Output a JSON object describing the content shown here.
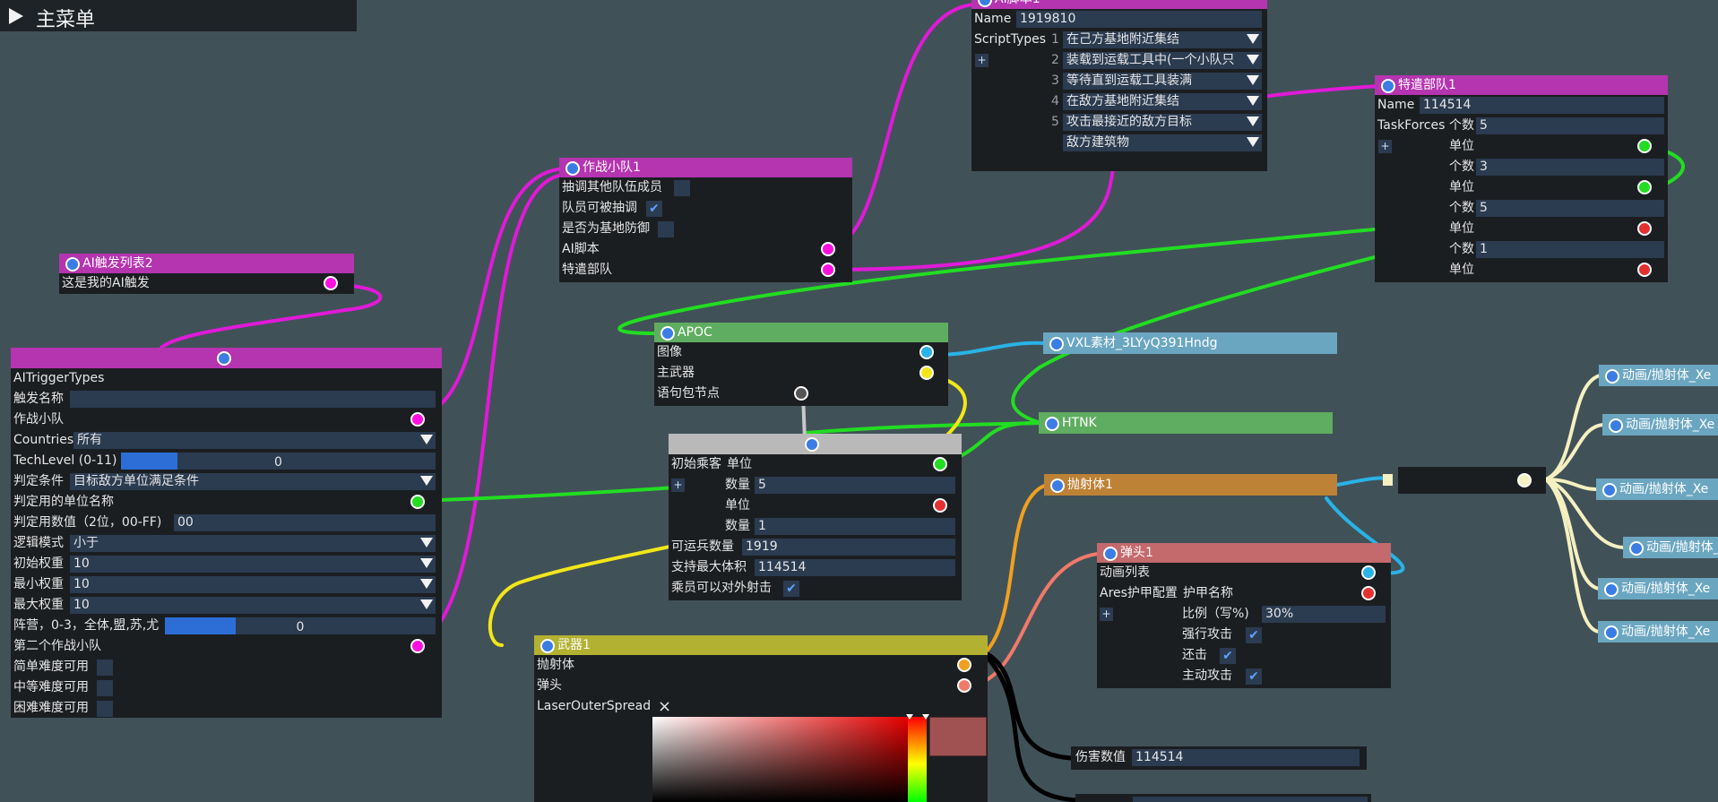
{
  "menu": {
    "title": "主菜单"
  },
  "colors": {
    "pink": "#b534b0",
    "green": "#5fad60",
    "grey": "#b9b9b9",
    "olive": "#b3b131",
    "orange": "#bd8236",
    "salmon": "#c4696c",
    "steel": "#6ba6c1"
  },
  "ai_trigger_list": {
    "title": "AI触发列表2",
    "text": "这是我的AI触发"
  },
  "ai_trigger": {
    "heading": "AITriggerTypes",
    "name_label": "触发名称",
    "team_label": "作战小队",
    "countries_label": "Countries",
    "countries_value": "所有",
    "techlevel_label": "TechLevel (0-11)",
    "techlevel_value": "0",
    "techlevel_fill": 0.18,
    "condition_label": "判定条件",
    "condition_value": "目标敌方单位满足条件",
    "unit_name_label": "判定用的单位名称",
    "hex_label": "判定用数值（2位，00-FF)",
    "hex_value": "00",
    "logic_label": "逻辑模式",
    "logic_value": "小于",
    "init_weight_label": "初始权重",
    "init_weight_value": "10",
    "min_weight_label": "最小权重",
    "min_weight_value": "10",
    "max_weight_label": "最大权重",
    "max_weight_value": "10",
    "camp_label": "阵营，0-3，全体,盟,苏,尤",
    "camp_value": "0",
    "camp_fill": 0.26,
    "second_team_label": "第二个作战小队",
    "easy_label": "简单难度可用",
    "medium_label": "中等难度可用",
    "hard_label": "困难难度可用"
  },
  "team": {
    "title": "作战小队1",
    "recruit_label": "抽调其他队伍成员",
    "can_be_recruited_label": "队员可被抽调",
    "base_defense_label": "是否为基地防御",
    "script_label": "AI脚本",
    "taskforce_label": "特遣部队"
  },
  "script": {
    "title": "AI脚本1",
    "name_label": "Name",
    "name_value": "1919810",
    "types_label": "ScriptTypes",
    "plus": "+",
    "items": [
      {
        "num": "1",
        "text": "在己方基地附近集结"
      },
      {
        "num": "2",
        "text": "装载到运载工具中(一个小队只"
      },
      {
        "num": "3",
        "text": "等待直到运载工具装满"
      },
      {
        "num": "4",
        "text": "在敌方基地附近集结"
      },
      {
        "num": "5",
        "text": "攻击最接近的敌方目标"
      },
      {
        "num": "",
        "text": "敌方建筑物"
      }
    ]
  },
  "taskforce": {
    "title": "特遣部队1",
    "name_label": "Name",
    "name_value": "114514",
    "tf_label": "TaskForces",
    "count_label": "个数",
    "count_value": "5",
    "plus": "+",
    "unit_label": "单位",
    "counts": [
      "3",
      "5",
      "1"
    ]
  },
  "apoc": {
    "title": "APOC",
    "image_label": "图像",
    "weapon_label": "主武器",
    "bundle_label": "语句包节点"
  },
  "vxl": {
    "title": "VXL素材_3LYyQ391Hndg"
  },
  "htnk": {
    "title": "HTNK"
  },
  "passengers": {
    "init_label": "初始乘客",
    "unit_label": "单位",
    "plus": "+",
    "count_label": "数量",
    "count1": "5",
    "count2": "1",
    "transport_label": "可运兵数量",
    "transport_value": "1919",
    "volume_label": "支持最大体积",
    "volume_value": "114514",
    "fire_label": "乘员可以对外射击"
  },
  "projectile": {
    "title": "抛射体1"
  },
  "warhead": {
    "title": "弹头1",
    "anim_label": "动画列表",
    "armor_label": "Ares护甲配置",
    "armor_name_label": "护甲名称",
    "plus": "+",
    "ratio_label": "比例（写%)",
    "ratio_value": "30%",
    "force_label": "强行攻击",
    "retaliate_label": "还击",
    "active_label": "主动攻击"
  },
  "weapon": {
    "title": "武器1",
    "proj_label": "抛射体",
    "warhead_label": "弹头",
    "spread_label": "LaserOuterSpread",
    "close": "×"
  },
  "damage": {
    "label": "伤害数值",
    "value": "114514"
  },
  "anims": [
    "动画/抛射体_Xe",
    "动画/抛射体_Xe",
    "动画/抛射体_Xe",
    "动画/抛射体_Xe",
    "动画/抛射体_Xe",
    "动画/抛射体_Xe"
  ]
}
